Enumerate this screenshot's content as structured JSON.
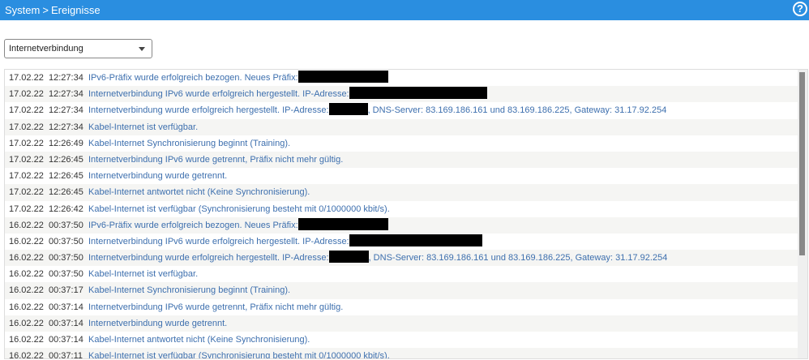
{
  "header": {
    "crumb1": "System",
    "sep": ">",
    "crumb2": "Ereignisse",
    "help": "?"
  },
  "filter": {
    "selected": "Internetverbindung"
  },
  "events": [
    {
      "date": "17.02.22",
      "time": "12:27:34",
      "pre": "IPv6-Präfix wurde erfolgreich bezogen. Neues Präfix:",
      "redact": 111,
      "post": ""
    },
    {
      "date": "17.02.22",
      "time": "12:27:34",
      "pre": "Internetverbindung IPv6 wurde erfolgreich hergestellt. IP-Adresse:",
      "redact": 170,
      "post": ""
    },
    {
      "date": "17.02.22",
      "time": "12:27:34",
      "pre": "Internetverbindung wurde erfolgreich hergestellt. IP-Adresse:",
      "redact": 48,
      "post": ", DNS-Server: 83.169.186.161 und 83.169.186.225, Gateway: 31.17.92.254"
    },
    {
      "date": "17.02.22",
      "time": "12:27:34",
      "pre": "Kabel-Internet ist verfügbar.",
      "redact": 0,
      "post": ""
    },
    {
      "date": "17.02.22",
      "time": "12:26:49",
      "pre": "Kabel-Internet Synchronisierung beginnt (Training).",
      "redact": 0,
      "post": ""
    },
    {
      "date": "17.02.22",
      "time": "12:26:45",
      "pre": "Internetverbindung IPv6 wurde getrennt, Präfix nicht mehr gültig.",
      "redact": 0,
      "post": ""
    },
    {
      "date": "17.02.22",
      "time": "12:26:45",
      "pre": "Internetverbindung wurde getrennt.",
      "redact": 0,
      "post": ""
    },
    {
      "date": "17.02.22",
      "time": "12:26:45",
      "pre": "Kabel-Internet antwortet nicht (Keine Synchronisierung).",
      "redact": 0,
      "post": ""
    },
    {
      "date": "17.02.22",
      "time": "12:26:42",
      "pre": "Kabel-Internet ist verfügbar (Synchronisierung besteht mit 0/1000000 kbit/s).",
      "redact": 0,
      "post": ""
    },
    {
      "date": "16.02.22",
      "time": "00:37:50",
      "pre": "IPv6-Präfix wurde erfolgreich bezogen. Neues Präfix:",
      "redact": 111,
      "post": ""
    },
    {
      "date": "16.02.22",
      "time": "00:37:50",
      "pre": "Internetverbindung IPv6 wurde erfolgreich hergestellt. IP-Adresse:",
      "redact": 164,
      "post": ""
    },
    {
      "date": "16.02.22",
      "time": "00:37:50",
      "pre": "Internetverbindung wurde erfolgreich hergestellt. IP-Adresse:",
      "redact": 49,
      "post": ", DNS-Server: 83.169.186.161 und 83.169.186.225, Gateway: 31.17.92.254"
    },
    {
      "date": "16.02.22",
      "time": "00:37:50",
      "pre": "Kabel-Internet ist verfügbar.",
      "redact": 0,
      "post": ""
    },
    {
      "date": "16.02.22",
      "time": "00:37:17",
      "pre": "Kabel-Internet Synchronisierung beginnt (Training).",
      "redact": 0,
      "post": ""
    },
    {
      "date": "16.02.22",
      "time": "00:37:14",
      "pre": "Internetverbindung IPv6 wurde getrennt, Präfix nicht mehr gültig.",
      "redact": 0,
      "post": ""
    },
    {
      "date": "16.02.22",
      "time": "00:37:14",
      "pre": "Internetverbindung wurde getrennt.",
      "redact": 0,
      "post": ""
    },
    {
      "date": "16.02.22",
      "time": "00:37:14",
      "pre": "Kabel-Internet antwortet nicht (Keine Synchronisierung).",
      "redact": 0,
      "post": ""
    },
    {
      "date": "16.02.22",
      "time": "00:37:11",
      "pre": "Kabel-Internet ist verfügbar (Synchronisierung besteht mit 0/1000000 kbit/s).",
      "redact": 0,
      "post": ""
    }
  ]
}
